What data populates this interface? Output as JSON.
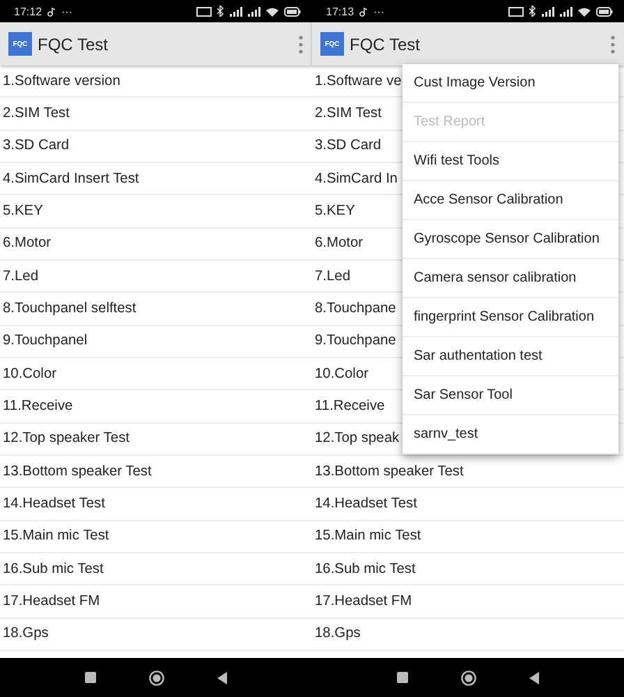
{
  "screens": [
    {
      "status_bar": {
        "time": "17:12",
        "extra": "···"
      },
      "app_bar": {
        "logo": "FQC",
        "title": "FQC Test"
      },
      "items": [
        "1.Software version",
        "2.SIM Test",
        "3.SD Card",
        "4.SimCard Insert Test",
        "5.KEY",
        "6.Motor",
        "7.Led",
        "8.Touchpanel selftest",
        "9.Touchpanel",
        "10.Color",
        "11.Receive",
        "12.Top speaker Test",
        "13.Bottom speaker Test",
        "14.Headset Test",
        "15.Main mic Test",
        "16.Sub mic Test",
        "17.Headset FM",
        "18.Gps"
      ]
    },
    {
      "status_bar": {
        "time": "17:13",
        "extra": "···"
      },
      "app_bar": {
        "logo": "FQC",
        "title": "FQC Test"
      },
      "items": [
        "1.Software ve",
        "2.SIM Test",
        "3.SD Card",
        "4.SimCard In",
        "5.KEY",
        "6.Motor",
        "7.Led",
        "8.Touchpane",
        "9.Touchpane",
        "10.Color",
        "11.Receive",
        "12.Top speak",
        "13.Bottom speaker Test",
        "14.Headset Test",
        "15.Main mic Test",
        "16.Sub mic Test",
        "17.Headset FM",
        "18.Gps"
      ],
      "menu": [
        {
          "label": "Cust Image Version",
          "disabled": false
        },
        {
          "label": "Test Report",
          "disabled": true
        },
        {
          "label": "Wifi test Tools",
          "disabled": false
        },
        {
          "label": "Acce Sensor Calibration",
          "disabled": false
        },
        {
          "label": "Gyroscope Sensor Calibration",
          "disabled": false
        },
        {
          "label": "Camera sensor calibration",
          "disabled": false
        },
        {
          "label": "fingerprint Sensor Calibration",
          "disabled": false
        },
        {
          "label": "Sar authentation test",
          "disabled": false
        },
        {
          "label": "Sar Sensor Tool",
          "disabled": false
        },
        {
          "label": "sarnv_test",
          "disabled": false
        }
      ]
    }
  ]
}
